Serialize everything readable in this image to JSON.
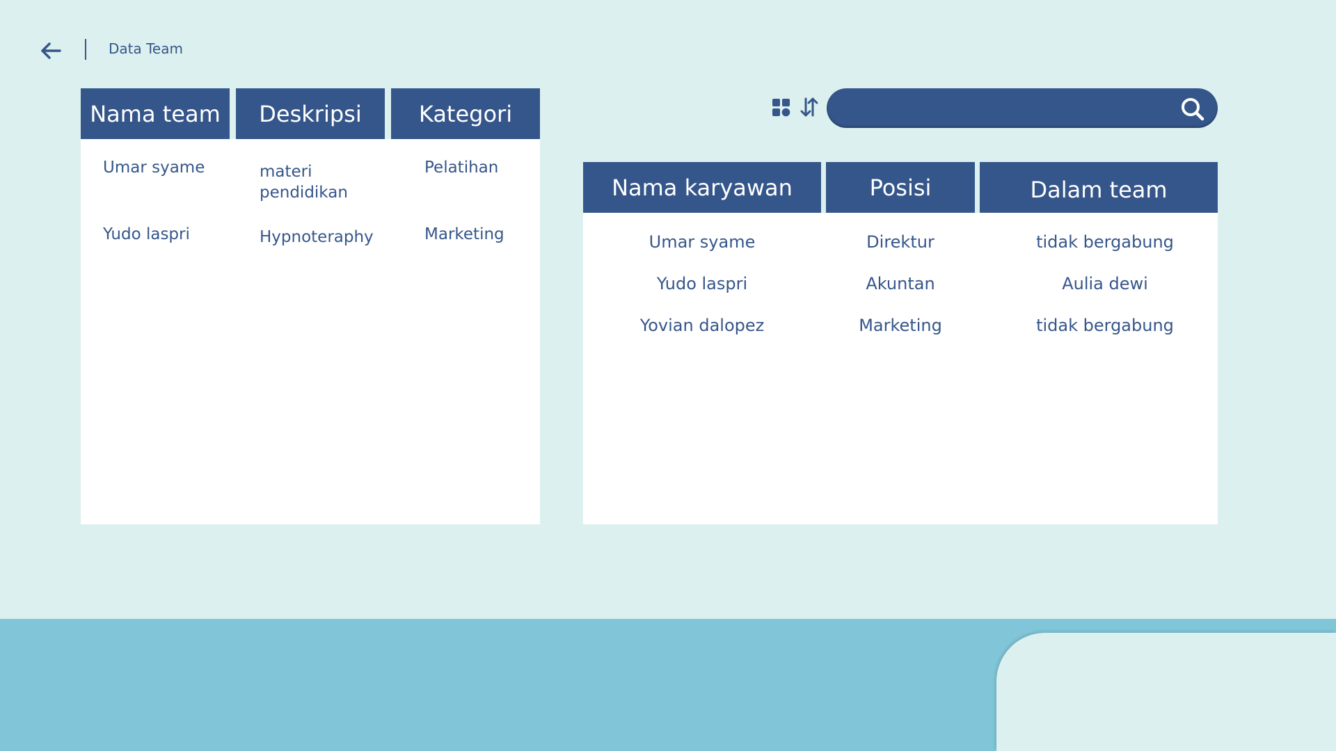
{
  "header": {
    "back_icon": "arrow-left-icon",
    "title": "Data Team"
  },
  "team_table": {
    "columns": [
      "Nama team",
      "Deskripsi",
      "Kategori"
    ],
    "rows": [
      {
        "nama_team": "Umar syame",
        "deskripsi": "materi pendidikan",
        "kategori": "Pelatihan"
      },
      {
        "nama_team": "Yudo laspri",
        "deskripsi": "Hypnoteraphy",
        "kategori": "Marketing"
      }
    ]
  },
  "toolbar": {
    "grid_icon": "grid-view-icon",
    "sort_icon": "sort-icon",
    "search": {
      "value": "",
      "placeholder": "",
      "icon": "search-icon"
    }
  },
  "employee_table": {
    "columns": [
      "Nama karyawan",
      "Posisi",
      "Dalam team"
    ],
    "rows": [
      {
        "nama": "Umar syame",
        "posisi": "Direktur",
        "dalam_team": "tidak bergabung"
      },
      {
        "nama": "Yudo laspri",
        "posisi": "Akuntan",
        "dalam_team": "Aulia dewi"
      },
      {
        "nama": "Yovian dalopez",
        "posisi": "Marketing",
        "dalam_team": "tidak bergabung"
      }
    ]
  },
  "colors": {
    "background": "#dcf1ef",
    "primary": "#35568a",
    "panel": "#ffffff",
    "footer": "#80c6d8"
  }
}
